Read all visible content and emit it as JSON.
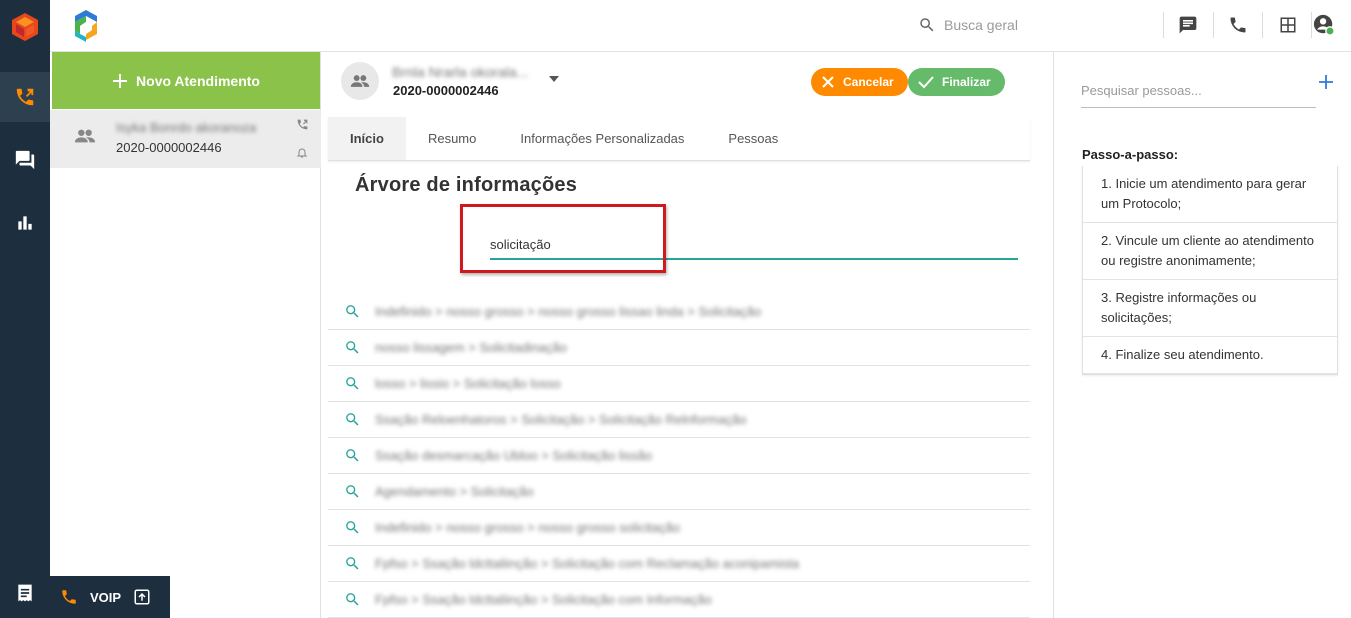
{
  "topbar": {
    "search_placeholder": "Busca geral"
  },
  "colors": {
    "rail": "#1d2f3f",
    "new_button": "#8bc34a",
    "cancel": "#ff8a00",
    "finalize": "#66bb6a",
    "accent_teal": "#26a69a",
    "highlight_red": "#d0191c"
  },
  "list": {
    "new_button_label": "Novo Atendimento",
    "items": [
      {
        "name": "Isyka Bonrdo akoranoza",
        "protocol": "2020-0000002446"
      }
    ]
  },
  "main": {
    "contact_name": "Brnla Nrarla okorala...",
    "protocol": "2020-0000002446",
    "cancel_label": "Cancelar",
    "finalize_label": "Finalizar",
    "tabs": [
      {
        "label": "Início",
        "active": true
      },
      {
        "label": "Resumo",
        "active": false
      },
      {
        "label": "Informações Personalizadas",
        "active": false
      },
      {
        "label": "Pessoas",
        "active": false
      }
    ],
    "tree_title": "Árvore de informações",
    "tree_search_value": "solicitação",
    "results": [
      "Indefinido > nosso grosso > nosso grosso lissao linda > Solicitação",
      "nosso lissagem > Solicitadinação",
      "losso > lissio > Solicitação losso",
      "Ssação Reloenhatoros > Solicitação > Solicitação Relnformação",
      "Ssação desmarcação Ubloo > Solicitação lissão",
      "Agendamento > Solicitação",
      "Indefinido > nosso grosso > nosso grosso solicitação",
      "Fpfso > Ssação ldcttaliinção > Solicitação com Reclamação aconipamista",
      "Fpfso > Ssação ldcttaliinção > Solicitação com Informação"
    ]
  },
  "right": {
    "people_search_placeholder": "Pesquisar pessoas...",
    "steps_title": "Passo-a-passo:",
    "steps": [
      "1. Inicie um atendimento para gerar um Protocolo;",
      "2. Vincule um cliente ao atendimento ou registre anonimamente;",
      "3. Registre informações ou solicitações;",
      "4. Finalize seu atendimento."
    ]
  },
  "voip": {
    "label": "VOIP"
  }
}
